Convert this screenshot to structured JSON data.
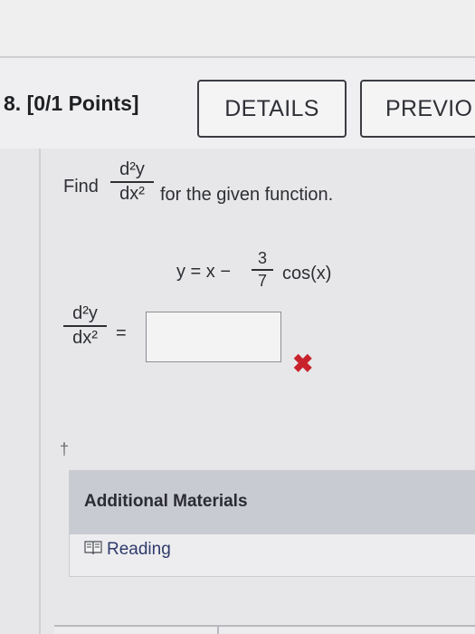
{
  "question": {
    "title": "8. [0/1 Points]"
  },
  "toolbar": {
    "details_label": "DETAILS",
    "previous_label": "PREVIO"
  },
  "prompt": {
    "find_word": "Find",
    "derivative_num": "d²y",
    "derivative_den": "dx²",
    "after_text": "for the given function."
  },
  "function": {
    "left": "y = x −",
    "fraction_num": "3",
    "fraction_den": "7",
    "right": "cos(x)"
  },
  "answer": {
    "label_num": "d²y",
    "label_den": "dx²",
    "equals": "=",
    "value": "",
    "status_icon": "x-mark-icon",
    "status_color": "#c8232c"
  },
  "note_marker": "†",
  "materials": {
    "title": "Additional Materials",
    "items": [
      {
        "label": "Reading",
        "icon": "book-icon"
      }
    ]
  }
}
